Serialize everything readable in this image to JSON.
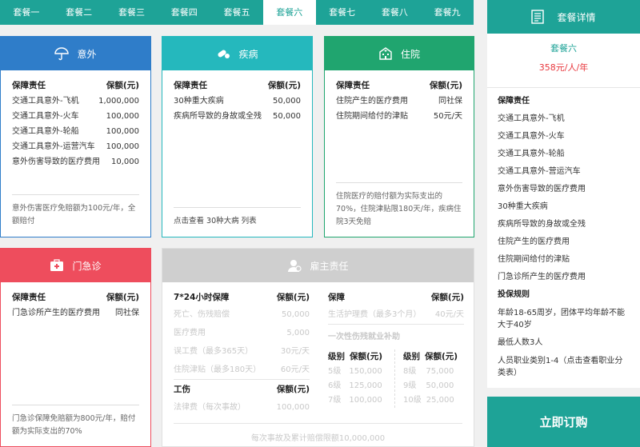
{
  "tabs": [
    "套餐一",
    "套餐二",
    "套餐三",
    "套餐四",
    "套餐五",
    "套餐六",
    "套餐七",
    "套餐八",
    "套餐九"
  ],
  "accident": {
    "title": "意外",
    "col1": "保障责任",
    "col2": "保额(元)",
    "rows": [
      [
        "交通工具意外-飞机",
        "1,000,000"
      ],
      [
        "交通工具意外-火车",
        "100,000"
      ],
      [
        "交通工具意外-轮船",
        "100,000"
      ],
      [
        "交通工具意外-运营汽车",
        "100,000"
      ],
      [
        "意外伤害导致的医疗费用",
        "10,000"
      ]
    ],
    "note": "意外伤害医疗免赔额为100元/年，全额赔付"
  },
  "disease": {
    "title": "疾病",
    "col1": "保障责任",
    "col2": "保额(元)",
    "rows": [
      [
        "30种重大疾病",
        "50,000"
      ],
      [
        "疾病所导致的身故或全残",
        "50,000"
      ]
    ],
    "note": "点击查看 30种大病 列表"
  },
  "hospital": {
    "title": "住院",
    "col1": "保障责任",
    "col2": "保额(元)",
    "rows": [
      [
        "住院产生的医疗费用",
        "同社保"
      ],
      [
        "住院期间给付的津贴",
        "50元/天"
      ]
    ],
    "note": "住院医疗的赔付额为实际支出的70%，住院津贴限180天/年，疾病住院3天免赔"
  },
  "er": {
    "title": "门急诊",
    "col1": "保障责任",
    "col2": "保额(元)",
    "rows": [
      [
        "门急诊所产生的医疗费用",
        "同社保"
      ]
    ],
    "note": "门急诊保障免赔额为800元/年，赔付额为实际支出的70%"
  },
  "employer": {
    "title": "雇主责任",
    "left": {
      "h1": "7*24小时保障",
      "h2": "保额(元)",
      "rows": [
        [
          "死亡、伤残赔偿",
          "50,000"
        ],
        [
          "医疗费用",
          "5,000"
        ],
        [
          "误工费（最多365天）",
          "30元/天"
        ],
        [
          "住院津贴（最多180天）",
          "60元/天"
        ]
      ],
      "h3": "工伤",
      "h4": "保额(元)",
      "rows2": [
        [
          "法律费（每次事故）",
          "100,000"
        ]
      ]
    },
    "right": {
      "h1": "保障",
      "h2": "保额(元)",
      "rows": [
        [
          "生活护理费（最多3个月）",
          "40元/天"
        ]
      ],
      "sub": "一次性伤残就业补助",
      "gh1": "级别",
      "gh2": "保额(元)",
      "grid1": [
        [
          "5级",
          "150,000"
        ],
        [
          "6级",
          "125,000"
        ],
        [
          "7级",
          "100,000"
        ]
      ],
      "grid2": [
        [
          "8级",
          "75,000"
        ],
        [
          "9级",
          "50,000"
        ],
        [
          "10级",
          "25,000"
        ]
      ]
    },
    "note": "每次事故及累计赔偿限额10,000,000"
  },
  "sidebar": {
    "title": "套餐详情",
    "plan": "套餐六",
    "price": "358元/人/年",
    "items": [
      "保障责任",
      "交通工具意外-飞机",
      "交通工具意外-火车",
      "交通工具意外-轮船",
      "交通工具意外-营运汽车",
      "意外伤害导致的医疗费用",
      "30种重大疾病",
      "疾病所导致的身故或全残",
      "住院产生的医疗费用",
      "住院期间给付的津贴",
      "门急诊所产生的医疗费用",
      "投保规则",
      "年龄18-65周岁，团体平均年龄不能大于40岁",
      "最低人数3人",
      "人员职业类别1-4（点击查看职业分类表）"
    ]
  },
  "buy": "立即订购"
}
